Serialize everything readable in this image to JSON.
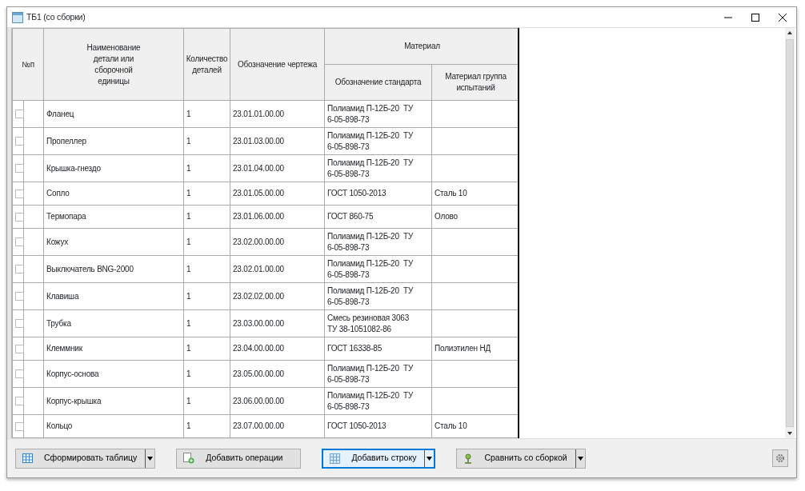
{
  "window": {
    "title": "ТБ1 (со сборки)"
  },
  "table": {
    "columns": [
      {
        "label": "№п"
      },
      {
        "label": "Наименование\nдетали или\nсборочной\nединицы"
      },
      {
        "label": "Количество\nдеталей"
      },
      {
        "label": "Обозначение чертежа"
      },
      {
        "label": "Материал",
        "children": [
          {
            "label": "Обозначение стандарта"
          },
          {
            "label": "Материал группа\nиспытаний"
          }
        ]
      }
    ],
    "rows": [
      {
        "checked": false,
        "name": "Фланец",
        "quantity": "1",
        "drawing": "23.01.01.00.00",
        "standard": "Полиамид П-12Б-20  ТУ\n6-05-898-73"
      },
      {
        "checked": false,
        "name": "Пропеллер",
        "quantity": "1",
        "drawing": "23.01.03.00.00",
        "standard": "Полиамид П-12Б-20  ТУ\n6-05-898-73"
      },
      {
        "checked": false,
        "name": "Крышка-гнездо",
        "quantity": "1",
        "drawing": "23.01.04.00.00",
        "standard": "Полиамид П-12Б-20  ТУ\n6-05-898-73"
      },
      {
        "checked": false,
        "name": "Сопло",
        "quantity": "1",
        "drawing": "23.01.05.00.00",
        "standard": "ГОСТ 1050-2013",
        "material": "Сталь 10"
      },
      {
        "checked": false,
        "name": "Термопара",
        "quantity": "1",
        "drawing": "23.01.06.00.00",
        "standard": "ГОСТ 860-75",
        "material": "Олово"
      },
      {
        "checked": false,
        "name": "Кожух",
        "quantity": "1",
        "drawing": "23.02.00.00.00",
        "standard": "Полиамид П-12Б-20  ТУ\n6-05-898-73"
      },
      {
        "checked": false,
        "name": "Выключатель BNG-2000",
        "quantity": "1",
        "drawing": "23.02.01.00.00",
        "standard": "Полиамид П-12Б-20  ТУ\n6-05-898-73"
      },
      {
        "checked": false,
        "name": "Клавиша",
        "quantity": "1",
        "drawing": "23.02.02.00.00",
        "standard": "Полиамид П-12Б-20  ТУ\n6-05-898-73"
      },
      {
        "checked": false,
        "name": "Трубка",
        "quantity": "1",
        "drawing": "23.03.00.00.00",
        "standard": "Смесь резиновая 3063\nТУ 38-1051082-86"
      },
      {
        "checked": false,
        "name": "Клеммник",
        "quantity": "1",
        "drawing": "23.04.00.00.00",
        "standard": "ГОСТ 16338-85",
        "material": "Полиэтилен НД"
      },
      {
        "checked": false,
        "name": "Корпус-основа",
        "quantity": "1",
        "drawing": "23.05.00.00.00",
        "standard": "Полиамид П-12Б-20  ТУ\n6-05-898-73"
      },
      {
        "checked": false,
        "name": "Корпус-крышка",
        "quantity": "1",
        "drawing": "23.06.00.00.00",
        "standard": "Полиамид П-12Б-20  ТУ\n6-05-898-73"
      },
      {
        "checked": false,
        "name": "Кольцо",
        "quantity": "1",
        "drawing": "23.07.00.00.00",
        "standard": "ГОСТ 1050-2013",
        "material": "Сталь 10"
      }
    ]
  },
  "toolbar": {
    "buttons": [
      {
        "kind": "table",
        "label": "Сформировать таблицу",
        "split": true,
        "focused": false
      },
      {
        "kind": "add",
        "label": "Добавить операции",
        "split": false,
        "focused": false
      },
      {
        "kind": "grid",
        "label": "Добавить строку",
        "split": true,
        "focused": true
      },
      {
        "kind": "compare",
        "label": "Сравнить со сборкой",
        "split": true,
        "focused": false
      }
    ]
  }
}
